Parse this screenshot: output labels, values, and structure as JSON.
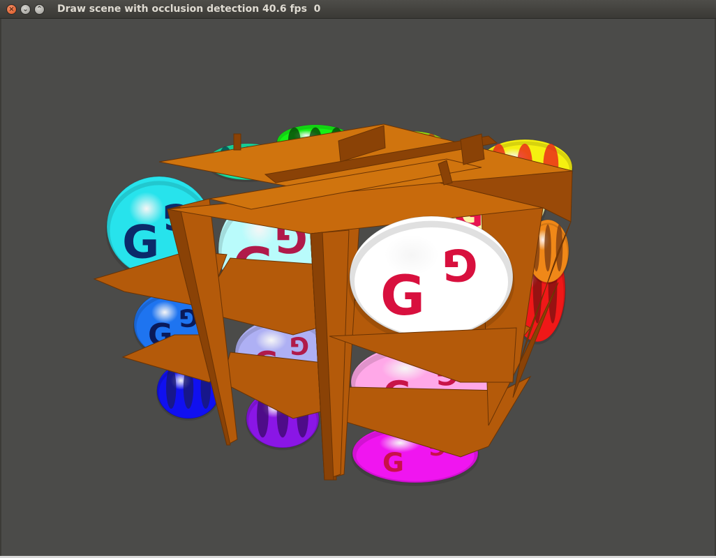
{
  "window": {
    "title": "Draw scene with occlusion detection 40.6 fps  0",
    "buttons": {
      "close": "×",
      "minimize": "⌄",
      "maximize": "⌃"
    }
  },
  "scene": {
    "background_color": "#4b4b49",
    "shelf_color": "#b45a0a",
    "shelf_dark": "#8a4206",
    "shelf_light": "#d0740e",
    "logo_glyph": "G",
    "colors": {
      "cyan": "#27e3ec",
      "light_cyan": "#b9fbfb",
      "white": "#ffffff",
      "blue": "#1e74f0",
      "lavender": "#aeb0f4",
      "pink": "#ffa8e8",
      "deep_blue": "#1010f0",
      "purple": "#8a16e6",
      "magenta": "#f015f0",
      "green": "#15f015",
      "lime": "#a8f010",
      "yellow": "#f5f010",
      "teal": "#18e8a8",
      "light_green": "#b8f4b8",
      "light_yellow": "#fbf6a8",
      "red": "#f01818",
      "orange": "#f08818"
    }
  }
}
